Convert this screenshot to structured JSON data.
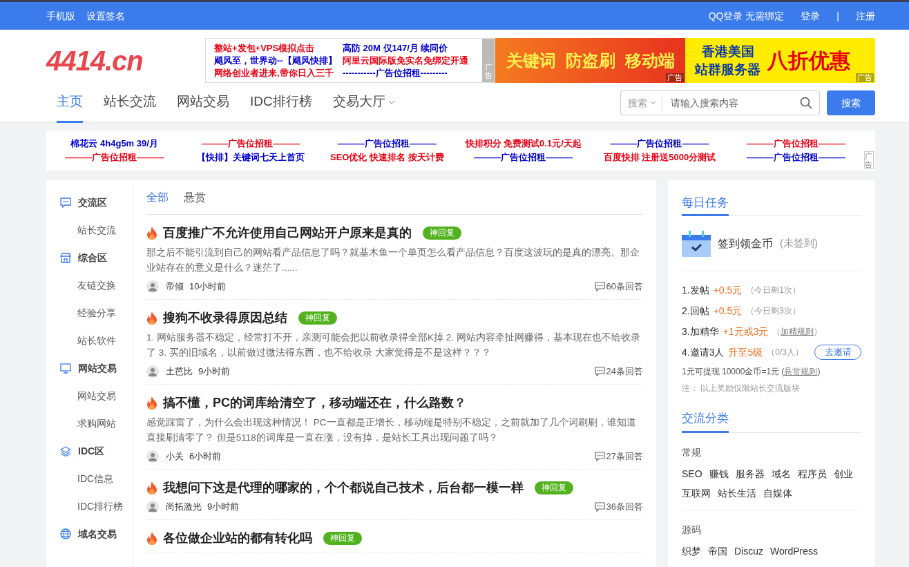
{
  "top_bar": {
    "left_links": [
      "手机版",
      "设置签名"
    ],
    "right_links": [
      "QQ登录 无需绑定",
      "登录",
      "|",
      "注册"
    ]
  },
  "header": {
    "logo": "4414.cn",
    "text_ad": {
      "columns": [
        [
          {
            "text": "整站+发包+VPS模拟点击",
            "color": "#e60012"
          },
          {
            "text": "飓风至，世界动--【飓风快排】",
            "color": "#0000cc"
          },
          {
            "text": "网络创业者进来,带你日入三千",
            "color": "#e60012"
          }
        ],
        [
          {
            "text": "高防 20M 仅147/月 续同价",
            "color": "#0000cc"
          },
          {
            "text": "阿里云国际版免实名免绑定开通",
            "color": "#e60012"
          },
          {
            "text": "-----------广告位招租---------",
            "color": "#0000cc"
          }
        ]
      ],
      "tag": "广告"
    },
    "banners": [
      {
        "kind": "orange",
        "words": [
          "关键词",
          "防盗刷",
          "移动端"
        ],
        "tag": "广告"
      },
      {
        "kind": "yellow",
        "words": [
          "香港美国",
          "站群服务器",
          "八折优惠"
        ],
        "tag": "广告"
      }
    ]
  },
  "nav": {
    "items": [
      {
        "label": "主页",
        "selected": true,
        "dropdown": false
      },
      {
        "label": "站长交流",
        "selected": false,
        "dropdown": false
      },
      {
        "label": "网站交易",
        "selected": false,
        "dropdown": false
      },
      {
        "label": "IDC排行榜",
        "selected": false,
        "dropdown": false
      },
      {
        "label": "交易大厅",
        "selected": false,
        "dropdown": true
      }
    ],
    "search": {
      "scope": "搜索",
      "placeholder": "请输入搜索内容",
      "button": "搜索"
    }
  },
  "ad_strip": {
    "columns": [
      [
        {
          "text": "棉花云 4h4g5m 39/月",
          "color": "#0000cc"
        },
        {
          "text": "———广告位招租———",
          "color": "#e60012"
        }
      ],
      [
        {
          "text": "———广告位招租———",
          "color": "#e60012"
        },
        {
          "text": "【快排】关键词七天上首页",
          "color": "#0000cc"
        }
      ],
      [
        {
          "text": "———广告位招租———",
          "color": "#0000cc"
        },
        {
          "text": "SEO优化 快速排名 按天计费",
          "color": "#e60012"
        }
      ],
      [
        {
          "text": "快排积分 免费测试0.1元/天起",
          "color": "#e60012"
        },
        {
          "text": "———广告位招租———",
          "color": "#0000cc"
        }
      ],
      [
        {
          "text": "———广告位招租———",
          "color": "#0000cc"
        },
        {
          "text": "百度快排 注册送5000分测试",
          "color": "#e60012"
        }
      ],
      [
        {
          "text": "———广告位招租———",
          "color": "#e60012"
        },
        {
          "text": "———广告位招租———",
          "color": "#0000cc"
        }
      ]
    ],
    "tag": "广告"
  },
  "sidebar": {
    "sections": [
      {
        "label": "交流区",
        "children": [
          "站长交流"
        ]
      },
      {
        "label": "综合区",
        "children": [
          "友链交换",
          "经验分享",
          "站长软件"
        ]
      },
      {
        "label": "网站交易",
        "children": [
          "网站交易",
          "求购网站"
        ]
      },
      {
        "label": "IDC区",
        "children": [
          "IDC信息",
          "IDC排行榜"
        ]
      },
      {
        "label": "域名交易"
      }
    ]
  },
  "feed": {
    "tabs": [
      {
        "label": "全部",
        "selected": true
      },
      {
        "label": "悬赏",
        "selected": false
      }
    ],
    "posts": [
      {
        "title": "百度推广不允许使用自己网站开户原来是真的",
        "badge": "神回复",
        "excerpt": "那之后不能引流到自己的网站看产品信息了吗？就基木鱼一个单页怎么看产品信息？百度这波玩的是真的漂亮。那企业站存在的意义是什么？迷茫了......",
        "author": "帝倾",
        "time": "10小时前",
        "replies": "60条回答"
      },
      {
        "title": "搜狗不收录得原因总结",
        "badge": "神回复",
        "excerpt": "1. 网站服务器不稳定，经常打不开，亲测可能会把以前收录得全部K掉 2. 网站内容牵扯网赚得，基本现在也不给收录了 3. 买的旧域名，以前做过微法得东西，也不给收录 大家觉得是不是这样？？？",
        "author": "土芭比",
        "time": "9小时前",
        "replies": "24条回答"
      },
      {
        "title": "搞不懂，PC的词库给清空了，移动端还在，什么路数？",
        "excerpt": "感觉踩雷了，为什么会出现这种情况！ PC一直都是正增长，移动端是特别不稳定，之前就加了几个词刷刷，谁知道直接刷清零了？ 但是5118的词库是一直在涨，没有掉，是站长工具出现问题了吗？",
        "author": "小关",
        "time": "6小时前",
        "replies": "27条回答"
      },
      {
        "title": "我想问下这是代理的哪家的，个个都说自己技术，后台都一模一样",
        "badge": "神回复",
        "author": "尚拓激光",
        "time": "9小时前",
        "replies": "36条回答"
      },
      {
        "title": "各位做企业站的都有转化吗",
        "badge": "神回复"
      }
    ]
  },
  "daily_tasks": {
    "title": "每日任务",
    "checkin": {
      "label": "签到领金币",
      "status": "(未签到)"
    },
    "tasks": [
      {
        "label": "1.发帖",
        "reward": "+0.5元",
        "note": [
          {
            "text": "（今日剩1次）",
            "link": false
          }
        ]
      },
      {
        "label": "2.回帖",
        "reward": "+0.5元",
        "note": [
          {
            "text": "（今日剩3次）",
            "link": false
          }
        ]
      },
      {
        "label": "3.加精华",
        "reward": "+1元或3元",
        "note": [
          {
            "text": "（",
            "link": false
          },
          {
            "text": "加精规则",
            "link": true
          },
          {
            "text": "）",
            "link": false
          }
        ]
      },
      {
        "label": "4.邀请3人",
        "reward": "升至5级",
        "note": [
          {
            "text": "（0/3人）",
            "link": false
          }
        ],
        "button": "去邀请"
      }
    ],
    "exchange": [
      {
        "text": "1元可提现 10000金币=1元 (",
        "link": false
      },
      {
        "text": "悬赏规则",
        "link": true
      },
      {
        "text": ")",
        "link": false
      }
    ],
    "footnote": "注： 以上奖励仅限站长交流版块"
  },
  "categories": {
    "title": "交流分类",
    "groups": [
      {
        "name": "常规",
        "tags": [
          "SEO",
          "赚钱",
          "服务器",
          "域名",
          "程序员",
          "创业",
          "互联网",
          "站长生活",
          "自媒体"
        ]
      },
      {
        "name": "源码",
        "tags": [
          "织梦",
          "帝国",
          "Discuz",
          "WordPress"
        ]
      }
    ]
  }
}
